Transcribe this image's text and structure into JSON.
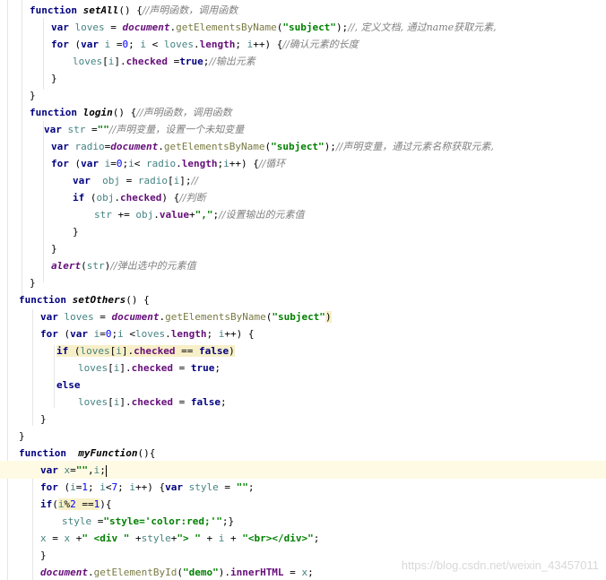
{
  "watermark": "https://blog.csdn.net/weixin_43457011",
  "lines": [
    {
      "indent": 33,
      "tokens": [
        [
          "kw",
          "function "
        ],
        [
          "fn",
          "setAll"
        ],
        [
          "plain",
          "() {"
        ],
        [
          "cmt",
          "//声明函数，调用函数"
        ]
      ]
    },
    {
      "indent": 57,
      "tokens": [
        [
          "kw",
          "var "
        ],
        [
          "id",
          "loves"
        ],
        [
          "plain",
          " = "
        ],
        [
          "obj",
          "document"
        ],
        [
          "plain",
          "."
        ],
        [
          "meth",
          "getElementsByName"
        ],
        [
          "plain",
          "("
        ],
        [
          "str",
          "\"subject\""
        ],
        [
          "plain",
          ");"
        ],
        [
          "cmt",
          "//, 定义文档, 通过name获取元素,"
        ]
      ]
    },
    {
      "indent": 57,
      "tokens": [
        [
          "kw",
          "for "
        ],
        [
          "plain",
          "("
        ],
        [
          "kw",
          "var "
        ],
        [
          "id",
          "i"
        ],
        [
          "plain",
          " ="
        ],
        [
          "num",
          "0"
        ],
        [
          "plain",
          "; "
        ],
        [
          "id",
          "i"
        ],
        [
          "plain",
          " < "
        ],
        [
          "id",
          "loves"
        ],
        [
          "plain",
          "."
        ],
        [
          "prop",
          "length"
        ],
        [
          "plain",
          "; "
        ],
        [
          "id",
          "i"
        ],
        [
          "plain",
          "++) {"
        ],
        [
          "cmt",
          "//确认元素的长度"
        ]
      ]
    },
    {
      "indent": 81,
      "tokens": [
        [
          "id",
          "loves"
        ],
        [
          "plain",
          "["
        ],
        [
          "id",
          "i"
        ],
        [
          "plain",
          "]."
        ],
        [
          "prop",
          "checked"
        ],
        [
          "plain",
          " ="
        ],
        [
          "kw",
          "true"
        ],
        [
          "plain",
          ";"
        ],
        [
          "cmt",
          "//输出元素"
        ]
      ]
    },
    {
      "indent": 57,
      "tokens": [
        [
          "plain",
          "}"
        ]
      ]
    },
    {
      "indent": 33,
      "tokens": [
        [
          "plain",
          "}"
        ]
      ]
    },
    {
      "indent": 33,
      "tokens": [
        [
          "kw",
          "function "
        ],
        [
          "fn",
          "login"
        ],
        [
          "plain",
          "() {"
        ],
        [
          "cmt",
          "//声明函数，调用函数"
        ]
      ]
    },
    {
      "indent": 49,
      "tokens": [
        [
          "kw",
          "var "
        ],
        [
          "id",
          "str"
        ],
        [
          "plain",
          " ="
        ],
        [
          "str",
          "\"\""
        ],
        [
          "cmt",
          "//声明变量，设置一个未知变量"
        ]
      ]
    },
    {
      "indent": 57,
      "tokens": [
        [
          "kw",
          "var "
        ],
        [
          "id",
          "radio"
        ],
        [
          "plain",
          "="
        ],
        [
          "obj",
          "document"
        ],
        [
          "plain",
          "."
        ],
        [
          "meth",
          "getElementsByName"
        ],
        [
          "plain",
          "("
        ],
        [
          "str",
          "\"subject\""
        ],
        [
          "plain",
          ");"
        ],
        [
          "cmt",
          "//声明变量，通过元素名称获取元素,"
        ]
      ]
    },
    {
      "indent": 57,
      "tokens": [
        [
          "kw",
          "for "
        ],
        [
          "plain",
          "("
        ],
        [
          "kw",
          "var "
        ],
        [
          "id",
          "i"
        ],
        [
          "plain",
          "="
        ],
        [
          "num",
          "0"
        ],
        [
          "plain",
          ";"
        ],
        [
          "id",
          "i"
        ],
        [
          "plain",
          "< "
        ],
        [
          "id",
          "radio"
        ],
        [
          "plain",
          "."
        ],
        [
          "prop",
          "length"
        ],
        [
          "plain",
          ";"
        ],
        [
          "id",
          "i"
        ],
        [
          "plain",
          "++) {"
        ],
        [
          "cmt",
          "//循环"
        ]
      ]
    },
    {
      "indent": 81,
      "tokens": [
        [
          "kw",
          "var  "
        ],
        [
          "id",
          "obj"
        ],
        [
          "plain",
          " = "
        ],
        [
          "id",
          "radio"
        ],
        [
          "plain",
          "["
        ],
        [
          "id",
          "i"
        ],
        [
          "plain",
          "];"
        ],
        [
          "cmt",
          "//"
        ]
      ]
    },
    {
      "indent": 81,
      "tokens": [
        [
          "kw",
          "if "
        ],
        [
          "plain",
          "("
        ],
        [
          "id",
          "obj"
        ],
        [
          "plain",
          "."
        ],
        [
          "prop",
          "checked"
        ],
        [
          "plain",
          ") {"
        ],
        [
          "cmt",
          "//判断"
        ]
      ]
    },
    {
      "indent": 105,
      "tokens": [
        [
          "id",
          "str"
        ],
        [
          "plain",
          " += "
        ],
        [
          "id",
          "obj"
        ],
        [
          "plain",
          "."
        ],
        [
          "prop",
          "value"
        ],
        [
          "plain",
          "+"
        ],
        [
          "str",
          "\",\""
        ],
        [
          "plain",
          ";"
        ],
        [
          "cmt",
          "//设置输出的元素值"
        ]
      ]
    },
    {
      "indent": 81,
      "tokens": [
        [
          "plain",
          "}"
        ]
      ]
    },
    {
      "indent": 57,
      "tokens": [
        [
          "plain",
          "}"
        ]
      ]
    },
    {
      "indent": 57,
      "tokens": [
        [
          "obj",
          "alert"
        ],
        [
          "plain",
          "("
        ],
        [
          "id",
          "str"
        ],
        [
          "plain",
          ")"
        ],
        [
          "cmt",
          "//弹出选中的元素值"
        ]
      ]
    },
    {
      "indent": 33,
      "tokens": [
        [
          "plain",
          "}"
        ]
      ]
    },
    {
      "indent": 21,
      "tokens": [
        [
          "kw",
          "function "
        ],
        [
          "fn",
          "setOthers"
        ],
        [
          "plain",
          "() {"
        ]
      ]
    },
    {
      "indent": 45,
      "tokens": [
        [
          "kw",
          "var "
        ],
        [
          "id",
          "loves"
        ],
        [
          "plain",
          " = "
        ],
        [
          "obj",
          "document"
        ],
        [
          "plain",
          "."
        ],
        [
          "meth",
          "getElementsByName"
        ],
        [
          "plain",
          "("
        ],
        [
          "str",
          "\"subject\""
        ],
        [
          "hl",
          ")"
        ]
      ]
    },
    {
      "indent": 45,
      "tokens": [
        [
          "kw",
          "for "
        ],
        [
          "plain",
          "("
        ],
        [
          "kw",
          "var "
        ],
        [
          "id",
          "i"
        ],
        [
          "plain",
          "="
        ],
        [
          "num",
          "0"
        ],
        [
          "plain",
          ";"
        ],
        [
          "id",
          "i"
        ],
        [
          "plain",
          " <"
        ],
        [
          "id",
          "loves"
        ],
        [
          "plain",
          "."
        ],
        [
          "prop",
          "length"
        ],
        [
          "plain",
          "; "
        ],
        [
          "id",
          "i"
        ],
        [
          "plain",
          "++) {"
        ]
      ]
    },
    {
      "indent": 63,
      "tokens": [
        [
          "hlkw",
          "if "
        ],
        [
          "hl",
          "("
        ],
        [
          "hlid",
          "loves"
        ],
        [
          "hl",
          "["
        ],
        [
          "hlid",
          "i"
        ],
        [
          "hl",
          "]."
        ],
        [
          "hlprop",
          "checked"
        ],
        [
          "hl",
          " == "
        ],
        [
          "hlkw",
          "false"
        ],
        [
          "hl",
          ")"
        ]
      ]
    },
    {
      "indent": 87,
      "tokens": [
        [
          "id",
          "loves"
        ],
        [
          "plain",
          "["
        ],
        [
          "id",
          "i"
        ],
        [
          "plain",
          "]."
        ],
        [
          "prop",
          "checked"
        ],
        [
          "plain",
          " = "
        ],
        [
          "kw",
          "true"
        ],
        [
          "plain",
          ";"
        ]
      ]
    },
    {
      "indent": 63,
      "tokens": [
        [
          "kw",
          "else"
        ]
      ]
    },
    {
      "indent": 87,
      "tokens": [
        [
          "id",
          "loves"
        ],
        [
          "plain",
          "["
        ],
        [
          "id",
          "i"
        ],
        [
          "plain",
          "]."
        ],
        [
          "prop",
          "checked"
        ],
        [
          "plain",
          " = "
        ],
        [
          "kw",
          "false"
        ],
        [
          "plain",
          ";"
        ]
      ]
    },
    {
      "indent": 45,
      "tokens": [
        [
          "plain",
          "}"
        ]
      ]
    },
    {
      "indent": 21,
      "tokens": [
        [
          "plain",
          "}"
        ]
      ]
    },
    {
      "indent": 21,
      "tokens": [
        [
          "kw",
          "function  "
        ],
        [
          "fn",
          "myFunction"
        ],
        [
          "plain",
          "(){"
        ]
      ]
    },
    {
      "indent": 45,
      "tokens": [
        [
          "kw",
          "var "
        ],
        [
          "id",
          "x"
        ],
        [
          "plain",
          "="
        ],
        [
          "str",
          "\"\""
        ],
        [
          "plain",
          ","
        ],
        [
          "id",
          "i"
        ],
        [
          "plain",
          ";"
        ],
        [
          "caret",
          ""
        ]
      ]
    },
    {
      "indent": 45,
      "tokens": [
        [
          "kw",
          "for "
        ],
        [
          "plain",
          "("
        ],
        [
          "id",
          "i"
        ],
        [
          "plain",
          "="
        ],
        [
          "num",
          "1"
        ],
        [
          "plain",
          "; "
        ],
        [
          "id",
          "i"
        ],
        [
          "plain",
          "<"
        ],
        [
          "num",
          "7"
        ],
        [
          "plain",
          "; "
        ],
        [
          "id",
          "i"
        ],
        [
          "plain",
          "++) {"
        ],
        [
          "kw",
          "var "
        ],
        [
          "id",
          "style"
        ],
        [
          "plain",
          " = "
        ],
        [
          "str",
          "\"\""
        ],
        [
          "plain",
          ";"
        ]
      ]
    },
    {
      "indent": 45,
      "tokens": [
        [
          "kw",
          "if"
        ],
        [
          "plain",
          "("
        ],
        [
          "hlid",
          "i"
        ],
        [
          "hl",
          "%"
        ],
        [
          "hlnum",
          "2"
        ],
        [
          "hl",
          " =="
        ],
        [
          "hlnum",
          "1"
        ],
        [
          "plain",
          "){"
        ]
      ]
    },
    {
      "indent": 69,
      "tokens": [
        [
          "id",
          "style"
        ],
        [
          "plain",
          " ="
        ],
        [
          "str",
          "\"style='color:red;'\""
        ],
        [
          "plain",
          ";}"
        ]
      ]
    },
    {
      "indent": 45,
      "tokens": [
        [
          "id",
          "x"
        ],
        [
          "plain",
          " = "
        ],
        [
          "id",
          "x"
        ],
        [
          "plain",
          " +"
        ],
        [
          "str",
          "\" <div \""
        ],
        [
          "plain",
          " +"
        ],
        [
          "id",
          "style"
        ],
        [
          "plain",
          "+"
        ],
        [
          "str",
          "\"> \""
        ],
        [
          "plain",
          " + "
        ],
        [
          "id",
          "i"
        ],
        [
          "plain",
          " + "
        ],
        [
          "str",
          "\"<br></div>\""
        ],
        [
          "plain",
          ";"
        ]
      ]
    },
    {
      "indent": 45,
      "tokens": [
        [
          "plain",
          "}"
        ]
      ]
    },
    {
      "indent": 45,
      "tokens": [
        [
          "obj",
          "document"
        ],
        [
          "plain",
          "."
        ],
        [
          "meth",
          "getElementById"
        ],
        [
          "plain",
          "("
        ],
        [
          "str",
          "\"demo\""
        ],
        [
          "plain",
          ")."
        ],
        [
          "prop",
          "innerHTML"
        ],
        [
          "plain",
          " = "
        ],
        [
          "id",
          "x"
        ],
        [
          "plain",
          ";"
        ]
      ]
    }
  ]
}
